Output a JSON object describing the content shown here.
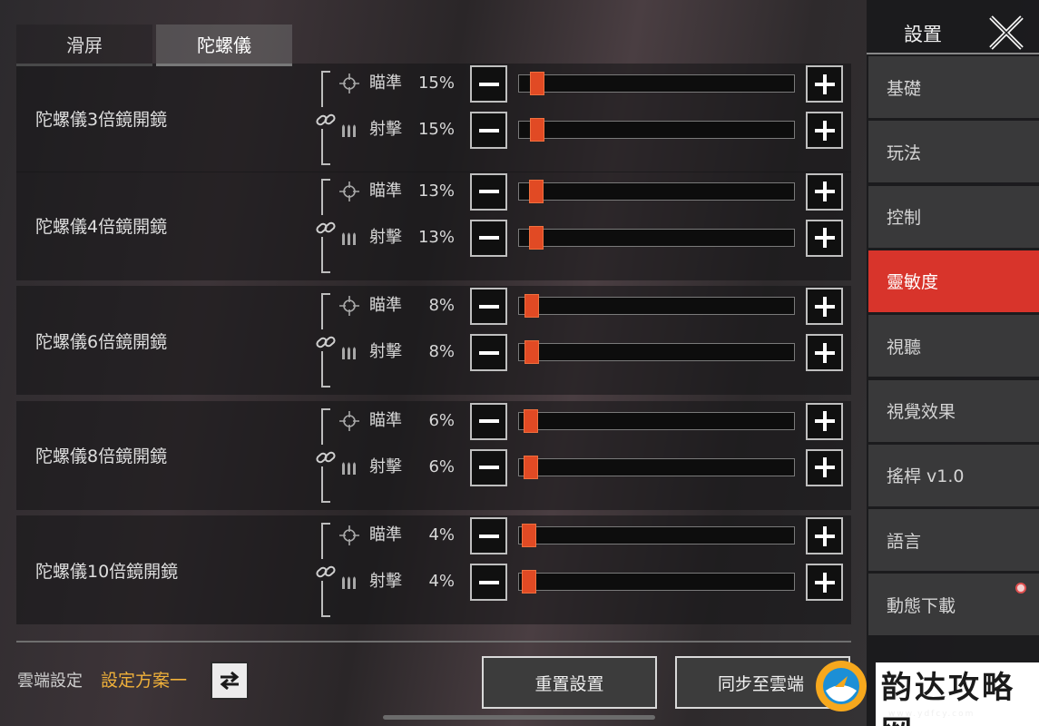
{
  "tabs": [
    {
      "label": "滑屏",
      "active": false
    },
    {
      "label": "陀螺儀",
      "active": true
    }
  ],
  "rows": [
    {
      "label": "陀螺儀3倍鏡開鏡",
      "aim_label": "瞄準",
      "aim_value": "15%",
      "aim_level": 0.15,
      "fire_label": "射擊",
      "fire_value": "15%",
      "fire_level": 0.15
    },
    {
      "label": "陀螺儀4倍鏡開鏡",
      "aim_label": "瞄準",
      "aim_value": "13%",
      "aim_level": 0.13,
      "fire_label": "射擊",
      "fire_value": "13%",
      "fire_level": 0.13
    },
    {
      "label": "陀螺儀6倍鏡開鏡",
      "aim_label": "瞄準",
      "aim_value": "8%",
      "aim_level": 0.08,
      "fire_label": "射擊",
      "fire_value": "8%",
      "fire_level": 0.08
    },
    {
      "label": "陀螺儀8倍鏡開鏡",
      "aim_label": "瞄準",
      "aim_value": "6%",
      "aim_level": 0.06,
      "fire_label": "射擊",
      "fire_value": "6%",
      "fire_level": 0.06
    },
    {
      "label": "陀螺儀10倍鏡開鏡",
      "aim_label": "瞄準",
      "aim_value": "4%",
      "aim_level": 0.04,
      "fire_label": "射擊",
      "fire_value": "4%",
      "fire_level": 0.04
    }
  ],
  "bottom": {
    "cloud_label": "雲端設定",
    "cloud_plan": "設定方案一",
    "reset_label": "重置設置",
    "sync_label": "同步至雲端"
  },
  "sidebar": {
    "title": "設置",
    "items": [
      {
        "label": "基礎",
        "active": false
      },
      {
        "label": "玩法",
        "active": false
      },
      {
        "label": "控制",
        "active": false
      },
      {
        "label": "靈敏度",
        "active": true
      },
      {
        "label": "視聽",
        "active": false
      },
      {
        "label": "視覺效果",
        "active": false
      },
      {
        "label": "搖桿 v1.0",
        "active": false
      },
      {
        "label": "語言",
        "active": false
      },
      {
        "label": "動態下載",
        "active": false,
        "badge": true
      }
    ]
  },
  "watermark": {
    "text": "韵达攻略网",
    "url": "www.ydfcy.com"
  },
  "colors": {
    "accent": "#d8342b",
    "slider_thumb": "#e14a24",
    "plan_text": "#f0b13a"
  }
}
